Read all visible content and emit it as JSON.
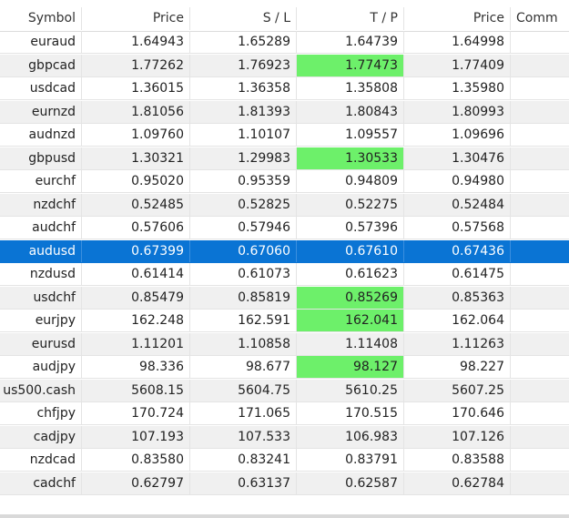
{
  "columns": {
    "symbol": "Symbol",
    "price": "Price",
    "sl": "S / L",
    "tp": "T / P",
    "price2": "Price",
    "comment": "Comm"
  },
  "colors": {
    "selected_row": "#0a74d4",
    "tp_hit": "#6df06a",
    "alt_row": "#f0f0f0"
  },
  "rows": [
    {
      "symbol": "euraud",
      "price": "1.64943",
      "sl": "1.65289",
      "tp": "1.64739",
      "price2": "1.64998",
      "tp_hit": false
    },
    {
      "symbol": "gbpcad",
      "price": "1.77262",
      "sl": "1.76923",
      "tp": "1.77473",
      "price2": "1.77409",
      "tp_hit": true
    },
    {
      "symbol": "usdcad",
      "price": "1.36015",
      "sl": "1.36358",
      "tp": "1.35808",
      "price2": "1.35980",
      "tp_hit": false
    },
    {
      "symbol": "eurnzd",
      "price": "1.81056",
      "sl": "1.81393",
      "tp": "1.80843",
      "price2": "1.80993",
      "tp_hit": false
    },
    {
      "symbol": "audnzd",
      "price": "1.09760",
      "sl": "1.10107",
      "tp": "1.09557",
      "price2": "1.09696",
      "tp_hit": false
    },
    {
      "symbol": "gbpusd",
      "price": "1.30321",
      "sl": "1.29983",
      "tp": "1.30533",
      "price2": "1.30476",
      "tp_hit": true
    },
    {
      "symbol": "eurchf",
      "price": "0.95020",
      "sl": "0.95359",
      "tp": "0.94809",
      "price2": "0.94980",
      "tp_hit": false
    },
    {
      "symbol": "nzdchf",
      "price": "0.52485",
      "sl": "0.52825",
      "tp": "0.52275",
      "price2": "0.52484",
      "tp_hit": false
    },
    {
      "symbol": "audchf",
      "price": "0.57606",
      "sl": "0.57946",
      "tp": "0.57396",
      "price2": "0.57568",
      "tp_hit": false
    },
    {
      "symbol": "audusd",
      "price": "0.67399",
      "sl": "0.67060",
      "tp": "0.67610",
      "price2": "0.67436",
      "tp_hit": false,
      "selected": true
    },
    {
      "symbol": "nzdusd",
      "price": "0.61414",
      "sl": "0.61073",
      "tp": "0.61623",
      "price2": "0.61475",
      "tp_hit": false
    },
    {
      "symbol": "usdchf",
      "price": "0.85479",
      "sl": "0.85819",
      "tp": "0.85269",
      "price2": "0.85363",
      "tp_hit": true
    },
    {
      "symbol": "eurjpy",
      "price": "162.248",
      "sl": "162.591",
      "tp": "162.041",
      "price2": "162.064",
      "tp_hit": true
    },
    {
      "symbol": "eurusd",
      "price": "1.11201",
      "sl": "1.10858",
      "tp": "1.11408",
      "price2": "1.11263",
      "tp_hit": false
    },
    {
      "symbol": "audjpy",
      "price": "98.336",
      "sl": "98.677",
      "tp": "98.127",
      "price2": "98.227",
      "tp_hit": true
    },
    {
      "symbol": "us500.cash",
      "price": "5608.15",
      "sl": "5604.75",
      "tp": "5610.25",
      "price2": "5607.25",
      "tp_hit": false
    },
    {
      "symbol": "chfjpy",
      "price": "170.724",
      "sl": "171.065",
      "tp": "170.515",
      "price2": "170.646",
      "tp_hit": false
    },
    {
      "symbol": "cadjpy",
      "price": "107.193",
      "sl": "107.533",
      "tp": "106.983",
      "price2": "107.126",
      "tp_hit": false
    },
    {
      "symbol": "nzdcad",
      "price": "0.83580",
      "sl": "0.83241",
      "tp": "0.83791",
      "price2": "0.83588",
      "tp_hit": false
    },
    {
      "symbol": "cadchf",
      "price": "0.62797",
      "sl": "0.63137",
      "tp": "0.62587",
      "price2": "0.62784",
      "tp_hit": false
    }
  ]
}
